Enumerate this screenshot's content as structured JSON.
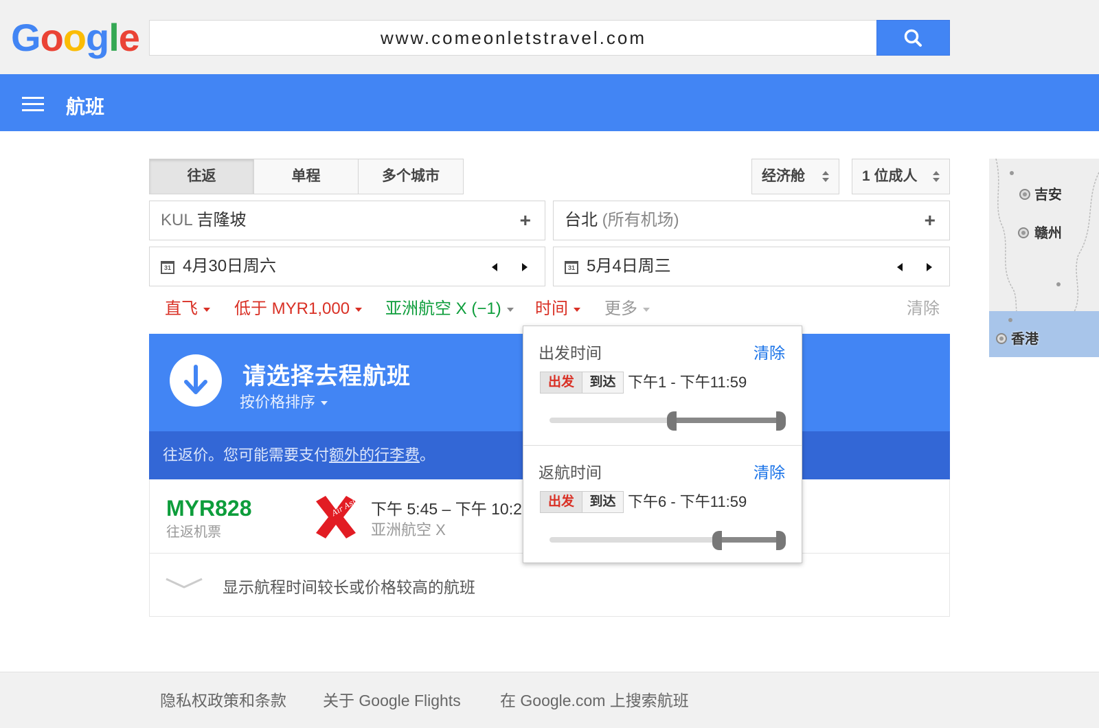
{
  "header": {
    "logo_letters": [
      {
        "ch": "G",
        "color": "#4285f4"
      },
      {
        "ch": "o",
        "color": "#ea4335"
      },
      {
        "ch": "o",
        "color": "#fbbc05"
      },
      {
        "ch": "g",
        "color": "#4285f4"
      },
      {
        "ch": "l",
        "color": "#34a853"
      },
      {
        "ch": "e",
        "color": "#ea4335"
      }
    ],
    "search_value": "www.comeonletstravel.com",
    "search_icon": "search-icon"
  },
  "nav": {
    "title": "航班",
    "menu_icon": "hamburger-menu-icon"
  },
  "trip_tabs": {
    "round_trip": "往返",
    "one_way": "单程",
    "multi_city": "多个城市",
    "active": "往返"
  },
  "cabin": {
    "label": "经济舱"
  },
  "passengers": {
    "label": "1 位成人"
  },
  "origin": {
    "code": "KUL",
    "city": "吉隆坡"
  },
  "destination": {
    "city": "台北",
    "hint": "(所有机场)"
  },
  "depart_date": {
    "icon_text": "31",
    "value": "4月30日周六"
  },
  "return_date": {
    "icon_text": "31",
    "value": "5月4日周三"
  },
  "filters": {
    "nonstop": "直飞",
    "price": "低于 MYR1,000",
    "airline": "亚洲航空 X (−1)",
    "time": "时间",
    "more": "更多",
    "clear": "清除",
    "active_color": "#d93025",
    "airline_color": "#0d9d3b"
  },
  "results": {
    "title": "请选择去程航班",
    "sort_label": "按价格排序",
    "note_prefix": "往返价。您可能需要支付",
    "note_link": "额外的行李费",
    "note_suffix": "。"
  },
  "flight": {
    "price": "MYR828",
    "price_type": "往返机票",
    "times": "下午 5:45 – 下午 10:2",
    "airline": "亚洲航空 X",
    "logo_text": "Air Asia"
  },
  "more_flights": {
    "label": "显示航程时间较长或价格较高的航班"
  },
  "time_popup": {
    "depart": {
      "title": "出发时间",
      "clear": "清除",
      "seg_depart": "出发",
      "seg_arrive": "到达",
      "range": "下午1 - 下午11:59",
      "range_start_fraction": 0.54,
      "range_end_fraction": 1.0
    },
    "return": {
      "title": "返航时间",
      "clear": "清除",
      "seg_depart": "出发",
      "seg_arrive": "到达",
      "range": "下午6 - 下午11:59",
      "range_start_fraction": 0.75,
      "range_end_fraction": 1.0
    }
  },
  "map": {
    "labels": [
      "吉安",
      "赣州",
      "香港"
    ]
  },
  "footer": {
    "privacy": "隐私权政策和条款",
    "about": "关于 Google Flights",
    "search_google": "在 Google.com 上搜索航班"
  }
}
